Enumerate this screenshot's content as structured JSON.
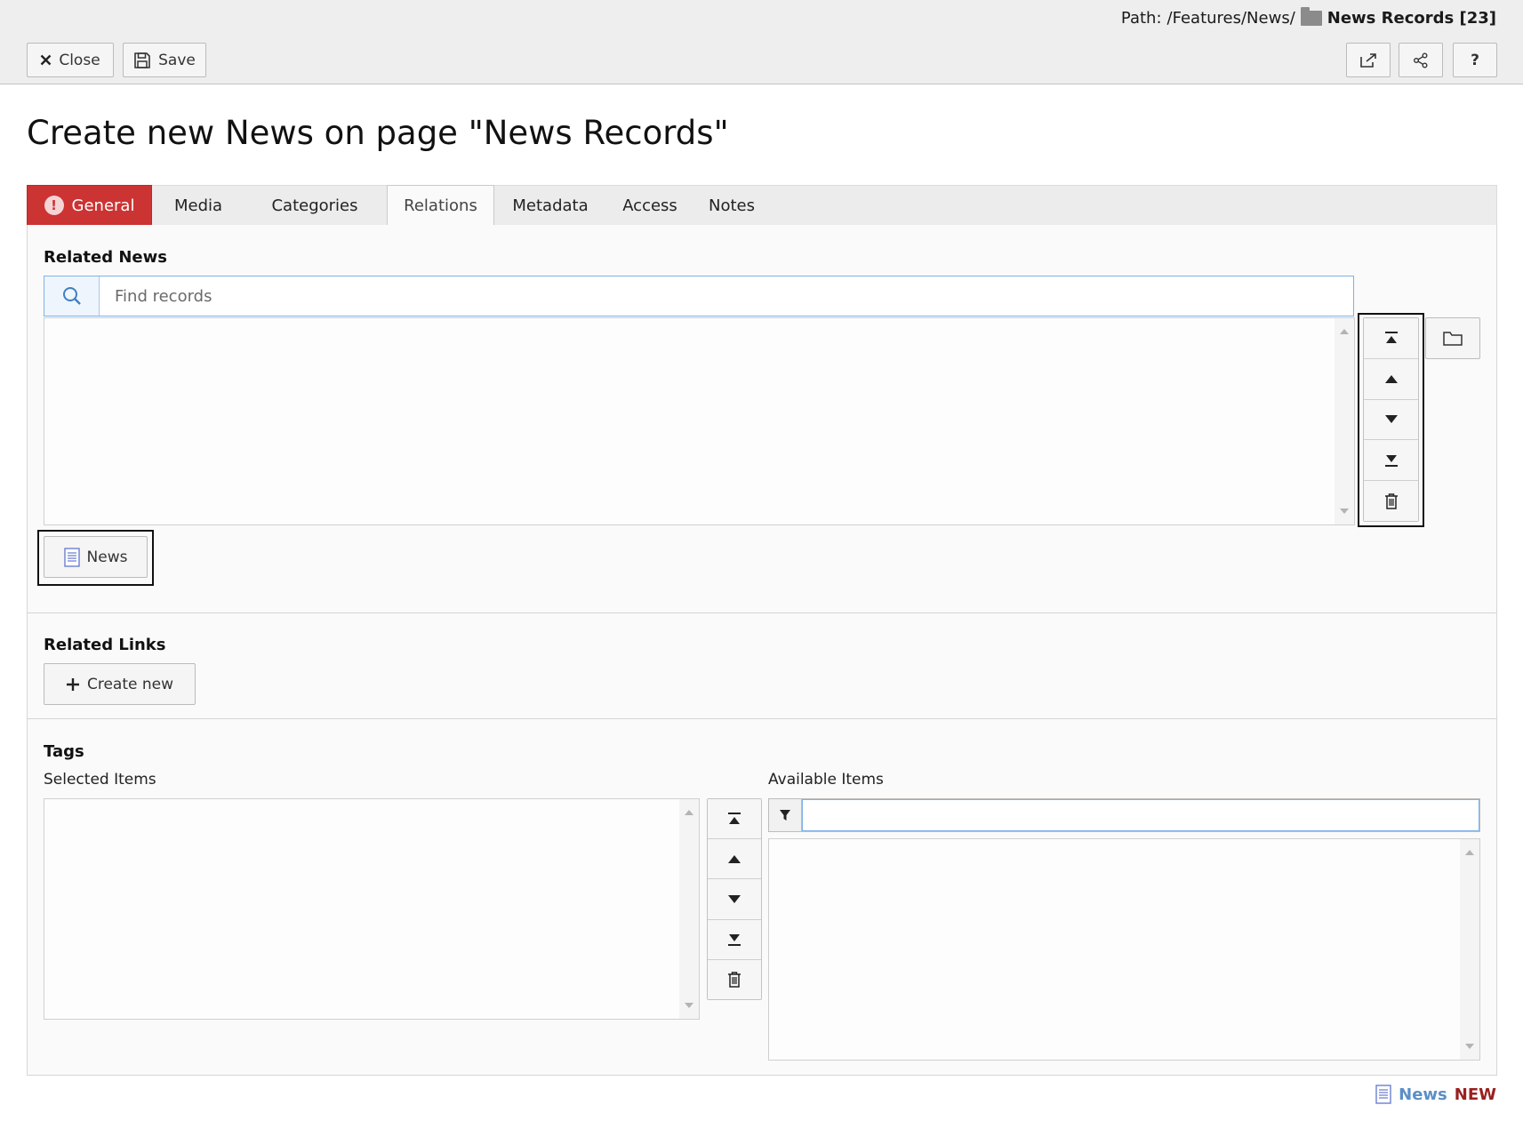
{
  "header": {
    "path_label": "Path:",
    "path_value": "/Features/News/",
    "page_name": "News Records [23]",
    "close_label": "Close",
    "save_label": "Save"
  },
  "title": "Create new News on page \"News Records\"",
  "tabs": [
    {
      "label": "General",
      "state": "error"
    },
    {
      "label": "Media"
    },
    {
      "label": "Categories"
    },
    {
      "label": "Relations",
      "state": "active"
    },
    {
      "label": "Metadata"
    },
    {
      "label": "Access"
    },
    {
      "label": "Notes"
    }
  ],
  "related_news": {
    "label": "Related News",
    "search_placeholder": "Find records",
    "add_button_label": "News"
  },
  "related_links": {
    "label": "Related Links",
    "create_label": "Create new"
  },
  "tags": {
    "label": "Tags",
    "selected_label": "Selected Items",
    "available_label": "Available Items",
    "filter_value": ""
  },
  "footer": {
    "type_label": "News",
    "status_label": "NEW"
  },
  "colors": {
    "error_tab": "#cc3333",
    "footer_type": "#5b8fc7",
    "footer_status": "#9b1f1f",
    "focus_border": "#7fb2e6"
  },
  "icons": [
    "close-icon",
    "save-icon",
    "external-link-icon",
    "share-icon",
    "help-icon",
    "folder-icon",
    "search-icon",
    "move-top-icon",
    "move-up-icon",
    "move-down-icon",
    "move-bottom-icon",
    "trash-icon",
    "news-record-icon",
    "plus-icon",
    "filter-icon"
  ]
}
